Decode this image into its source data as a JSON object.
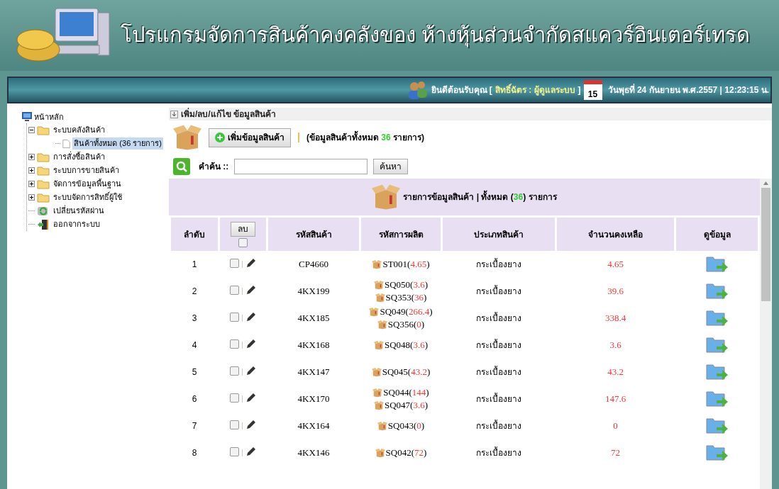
{
  "header": {
    "title": "โปรแกรมจัดการสินค้าคงคลังของ ห้างหุ้นส่วนจำกัดสแควร์อินเตอร์เทรด"
  },
  "topbar": {
    "welcome": "ยินดีต้อนรับคุณ [",
    "user_role": "สิทธิ์ฉัตร : ผู้ดูแลระบบ",
    "welcome_end": "]",
    "calendar_day": "15",
    "date_time": "วันพุธที่ 24 กันยายน พ.ศ.2557 | 12:23:15 น."
  },
  "sidebar": {
    "root": "หน้าหลัก",
    "items": [
      {
        "label": "ระบบคลังสินค้า",
        "kind": "folder",
        "expanded": true,
        "selected": false,
        "children": [
          {
            "label": "สินค้าทั้งหมด (36 รายการ)",
            "kind": "page",
            "selected": true
          }
        ]
      },
      {
        "label": "การสั่งซื้อสินค้า",
        "kind": "folder",
        "expanded": false,
        "selected": false
      },
      {
        "label": "ระบบการขายสินค้า",
        "kind": "folder",
        "expanded": false,
        "selected": false
      },
      {
        "label": "จัดการข้อมูลพื้นฐาน",
        "kind": "folder",
        "expanded": false,
        "selected": false
      },
      {
        "label": "ระบบจัดการสิทธิ์ผู้ใช้",
        "kind": "folder",
        "expanded": false,
        "selected": false
      },
      {
        "label": "เปลี่ยนรหัสผ่าน",
        "kind": "password",
        "selected": false
      },
      {
        "label": "ออกจากระบบ",
        "kind": "logout",
        "selected": false
      }
    ]
  },
  "section_title": "เพิ่ม/ลบ/แก้ไข ข้อมูลสินค้า",
  "add_button": "เพิ่มข้อมูลสินค้า",
  "summary": {
    "prefix": "(ข้อมูลสินค้าทั้งหมด",
    "count": "36",
    "suffix": "รายการ)"
  },
  "search": {
    "label": "คำค้น ::",
    "button": "ค้นหา"
  },
  "table": {
    "title": {
      "prefix": "รายการข้อมูลสินค้า | ทั้งหมด (",
      "count": "36",
      "suffix": ") รายการ"
    },
    "columns": [
      "ลำดับ",
      "ลบ",
      "รหัสสินค้า",
      "รหัสการผลิต",
      "ประเภทสินค้า",
      "จำนวนคงเหลือ",
      "ดูข้อมูล"
    ],
    "select_all_checked": false,
    "rows": [
      {
        "index": "1",
        "checked": false,
        "product_code": "CP4660",
        "production_codes": [
          {
            "code": "ST001",
            "open": "(",
            "qty": "4.65",
            "close": ")"
          }
        ],
        "type": "กระเบื้องยาง",
        "remaining": "4.65"
      },
      {
        "index": "2",
        "checked": false,
        "product_code": "4KX199",
        "production_codes": [
          {
            "code": "SQ050",
            "open": "(",
            "qty": "3.6",
            "close": ")"
          },
          {
            "code": "SQ353",
            "open": "(",
            "qty": "36",
            "close": ")"
          }
        ],
        "type": "กระเบื้องยาง",
        "remaining": "39.6"
      },
      {
        "index": "3",
        "checked": false,
        "product_code": "4KX185",
        "production_codes": [
          {
            "code": "SQ049",
            "open": "(",
            "qty": "266.4",
            "close": ")"
          },
          {
            "code": "SQ356",
            "open": "(",
            "qty": "0",
            "close": ")"
          }
        ],
        "type": "กระเบื้องยาง",
        "remaining": "338.4"
      },
      {
        "index": "4",
        "checked": false,
        "product_code": "4KX168",
        "production_codes": [
          {
            "code": "SQ048",
            "open": "(",
            "qty": "3.6",
            "close": ")"
          }
        ],
        "type": "กระเบื้องยาง",
        "remaining": "3.6"
      },
      {
        "index": "5",
        "checked": false,
        "product_code": "4KX147",
        "production_codes": [
          {
            "code": "SQ045",
            "open": "(",
            "qty": "43.2",
            "close": ")"
          }
        ],
        "type": "กระเบื้องยาง",
        "remaining": "43.2"
      },
      {
        "index": "6",
        "checked": false,
        "product_code": "4KX170",
        "production_codes": [
          {
            "code": "SQ044",
            "open": "(",
            "qty": "144",
            "close": ")"
          },
          {
            "code": "SQ047",
            "open": "(",
            "qty": "3.6",
            "close": ")"
          }
        ],
        "type": "กระเบื้องยาง",
        "remaining": "147.6"
      },
      {
        "index": "7",
        "checked": false,
        "product_code": "4KX164",
        "production_codes": [
          {
            "code": "SQ043",
            "open": "(",
            "qty": "0",
            "close": ")"
          }
        ],
        "type": "กระเบื้องยาง",
        "remaining": "0"
      },
      {
        "index": "8",
        "checked": false,
        "product_code": "4KX146",
        "production_codes": [
          {
            "code": "SQ042",
            "open": "(",
            "qty": "72",
            "close": ")"
          }
        ],
        "type": "กระเบื้องยาง",
        "remaining": "72"
      }
    ]
  }
}
